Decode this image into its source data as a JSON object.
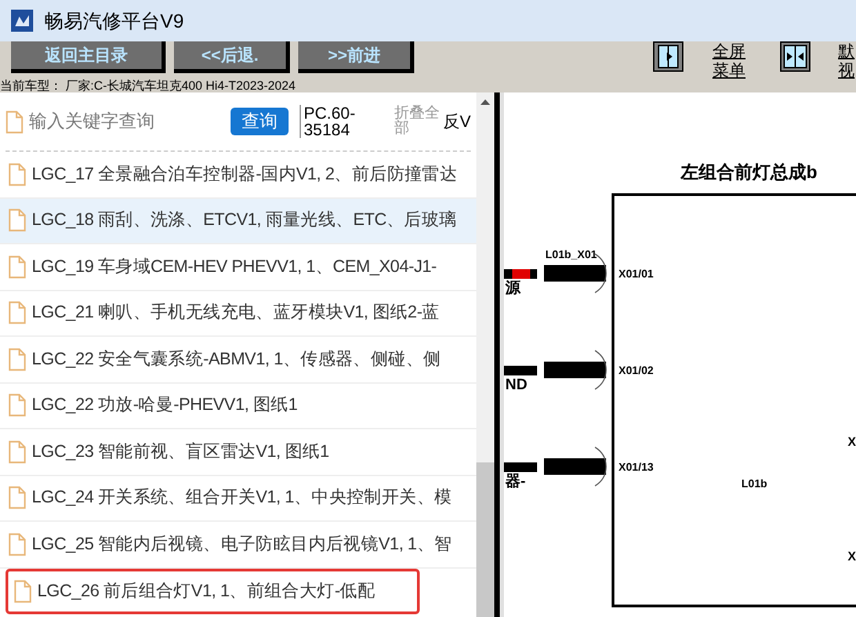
{
  "window": {
    "title": "畅易汽修平台V9"
  },
  "toolbar": {
    "buttons": [
      "返回主目录",
      "<<后退.",
      ">>前进"
    ],
    "tools": [
      {
        "kind": "expand",
        "label": "全屏菜单"
      },
      {
        "kind": "split",
        "label": "默视"
      }
    ]
  },
  "vehicle_info": "当前车型： 厂家:C-长城汽车坦克400 Hi4-T2023-2024",
  "search": {
    "placeholder": "输入关键字查询",
    "button": "查询",
    "code": "PC.60-35184",
    "collapse": "折叠全部",
    "column_5": "反V"
  },
  "documents": [
    {
      "label": "LGC_17 全景融合泊车控制器-国内V1, 2、前后防撞雷达",
      "selected": false,
      "outlined": false
    },
    {
      "label": "LGC_18 雨刮、洗涤、ETCV1, 雨量光线、ETC、后玻璃",
      "selected": true,
      "outlined": false
    },
    {
      "label": "LGC_19 车身域CEM-HEV PHEVV1, 1、CEM_X04-J1-",
      "selected": false,
      "outlined": false
    },
    {
      "label": "LGC_21 喇叭、手机无线充电、蓝牙模块V1, 图纸2-蓝",
      "selected": false,
      "outlined": false
    },
    {
      "label": "LGC_22 安全气囊系统-ABMV1, 1、传感器、侧碰、侧",
      "selected": false,
      "outlined": false
    },
    {
      "label": "LGC_22 功放-哈曼-PHEVV1, 图纸1",
      "selected": false,
      "outlined": false
    },
    {
      "label": "LGC_23 智能前视、盲区雷达V1, 图纸1",
      "selected": false,
      "outlined": false
    },
    {
      "label": "LGC_24 开关系统、组合开关V1, 1、中央控制开关、模",
      "selected": false,
      "outlined": false
    },
    {
      "label": "LGC_25 智能内后视镜、电子防眩目内后视镜V1, 1、智",
      "selected": false,
      "outlined": false
    },
    {
      "label": "LGC_26 前后组合灯V1, 1、前组合大灯-低配",
      "selected": false,
      "outlined": true
    }
  ],
  "diagram": {
    "title": "左组合前灯总成b",
    "connector": "L01b_X01",
    "component": "L01b",
    "pins": [
      {
        "label": "X01/01",
        "wire": "源",
        "color": "#e00000"
      },
      {
        "label": "X01/02",
        "wire": "ND",
        "color": "#000000"
      },
      {
        "label": "X01/13",
        "wire": "器-",
        "color": "#000000"
      }
    ],
    "edge_labels": [
      "X",
      "X"
    ]
  }
}
